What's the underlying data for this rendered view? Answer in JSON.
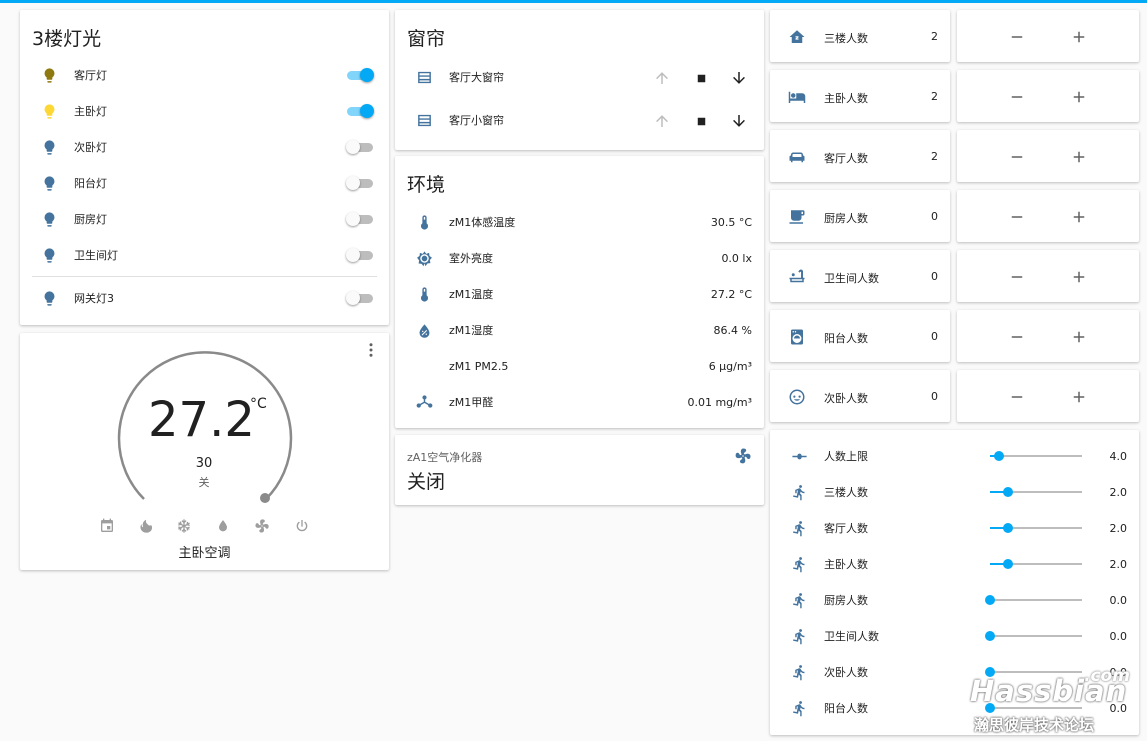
{
  "colors": {
    "accent": "#03a9f4",
    "icon_default": "#44739e",
    "bulb_on": "#fdd835",
    "bulb_dim": "#8f7a11"
  },
  "lights": {
    "title": "3楼灯光",
    "items": [
      {
        "label": "客厅灯",
        "state": "on",
        "icon": "lightbulb-icon"
      },
      {
        "label": "主卧灯",
        "state": "on",
        "icon": "lightbulb-icon"
      },
      {
        "label": "次卧灯",
        "state": "off",
        "icon": "lightbulb-icon"
      },
      {
        "label": "阳台灯",
        "state": "off",
        "icon": "lightbulb-icon"
      },
      {
        "label": "厨房灯",
        "state": "off",
        "icon": "lightbulb-icon"
      },
      {
        "label": "卫生间灯",
        "state": "off",
        "icon": "lightbulb-icon"
      }
    ],
    "extra": {
      "label": "网关灯3",
      "state": "off",
      "icon": "lightbulb-icon"
    }
  },
  "thermostat": {
    "temperature": "27.2",
    "unit": "°C",
    "setpoint": "30",
    "mode_label": "关",
    "name": "主卧空调",
    "modes": [
      "calendar-icon",
      "fire-icon",
      "snowflake-icon",
      "water-icon",
      "fan-icon",
      "power-icon"
    ]
  },
  "curtains": {
    "title": "窗帘",
    "items": [
      {
        "label": "客厅大窗帘",
        "icon": "window-shutter-icon"
      },
      {
        "label": "客厅小窗帘",
        "icon": "window-shutter-icon"
      }
    ]
  },
  "environment": {
    "title": "环境",
    "items": [
      {
        "label": "zM1体感温度",
        "value": "30.5 °C",
        "icon": "thermometer-icon"
      },
      {
        "label": "室外亮度",
        "value": "0.0 lx",
        "icon": "brightness-icon"
      },
      {
        "label": "zM1温度",
        "value": "27.2 °C",
        "icon": "thermometer-icon"
      },
      {
        "label": "zM1湿度",
        "value": "86.4 %",
        "icon": "water-percent-icon"
      },
      {
        "label": "zM1 PM2.5",
        "value": "6 μg/m³",
        "icon": "dots-grid-icon"
      },
      {
        "label": "zM1甲醛",
        "value": "0.01 mg/m³",
        "icon": "molecule-icon"
      }
    ]
  },
  "purifier": {
    "name": "zA1空气净化器",
    "state": "关闭",
    "icon": "fan-icon"
  },
  "counters": [
    {
      "label": "三楼人数",
      "value": "2",
      "icon": "home-floor-3-icon"
    },
    {
      "label": "主卧人数",
      "value": "2",
      "icon": "bed-icon"
    },
    {
      "label": "客厅人数",
      "value": "2",
      "icon": "sofa-icon"
    },
    {
      "label": "厨房人数",
      "value": "0",
      "icon": "coffee-icon"
    },
    {
      "label": "卫生间人数",
      "value": "0",
      "icon": "bathtub-icon"
    },
    {
      "label": "阳台人数",
      "value": "0",
      "icon": "washing-machine-icon"
    },
    {
      "label": "次卧人数",
      "value": "0",
      "icon": "baby-face-icon"
    }
  ],
  "counter_buttons": {
    "minus": "−",
    "plus": "+"
  },
  "sliders": [
    {
      "label": "人数上限",
      "value": "4.0",
      "fraction": 0.1,
      "icon": "ray-vertex-icon"
    },
    {
      "label": "三楼人数",
      "value": "2.0",
      "fraction": 0.2,
      "icon": "run-icon"
    },
    {
      "label": "客厅人数",
      "value": "2.0",
      "fraction": 0.2,
      "icon": "run-icon"
    },
    {
      "label": "主卧人数",
      "value": "2.0",
      "fraction": 0.2,
      "icon": "run-icon"
    },
    {
      "label": "厨房人数",
      "value": "0.0",
      "fraction": 0,
      "icon": "run-icon"
    },
    {
      "label": "卫生间人数",
      "value": "0.0",
      "fraction": 0,
      "icon": "run-icon"
    },
    {
      "label": "次卧人数",
      "value": "0.0",
      "fraction": 0,
      "icon": "run-icon"
    },
    {
      "label": "阳台人数",
      "value": "0.0",
      "fraction": 0,
      "icon": "run-icon"
    }
  ],
  "watermark": {
    "brand": "Hassbian",
    "suffix": ".com",
    "tagline": "瀚思彼岸技术论坛"
  }
}
